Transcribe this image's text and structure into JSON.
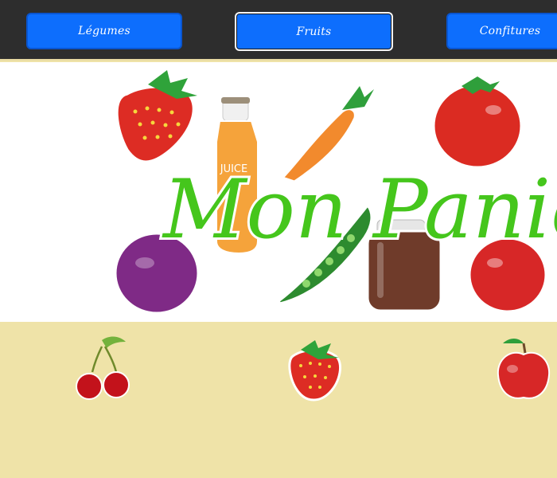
{
  "nav": {
    "items": [
      {
        "label": "Légumes",
        "active": false
      },
      {
        "label": "Fruits",
        "active": true
      },
      {
        "label": "Confitures",
        "active": false
      }
    ]
  },
  "banner": {
    "title": "Mon Panier",
    "juice_label": "JUICE"
  },
  "products": [
    {
      "icon": "cherry-icon"
    },
    {
      "icon": "strawberry-icon"
    },
    {
      "icon": "apple-icon"
    }
  ],
  "colors": {
    "button_blue": "#0d6efd",
    "topbar": "#2d2d2d",
    "page_background": "#efe3a8",
    "title_green": "#45c61c"
  }
}
